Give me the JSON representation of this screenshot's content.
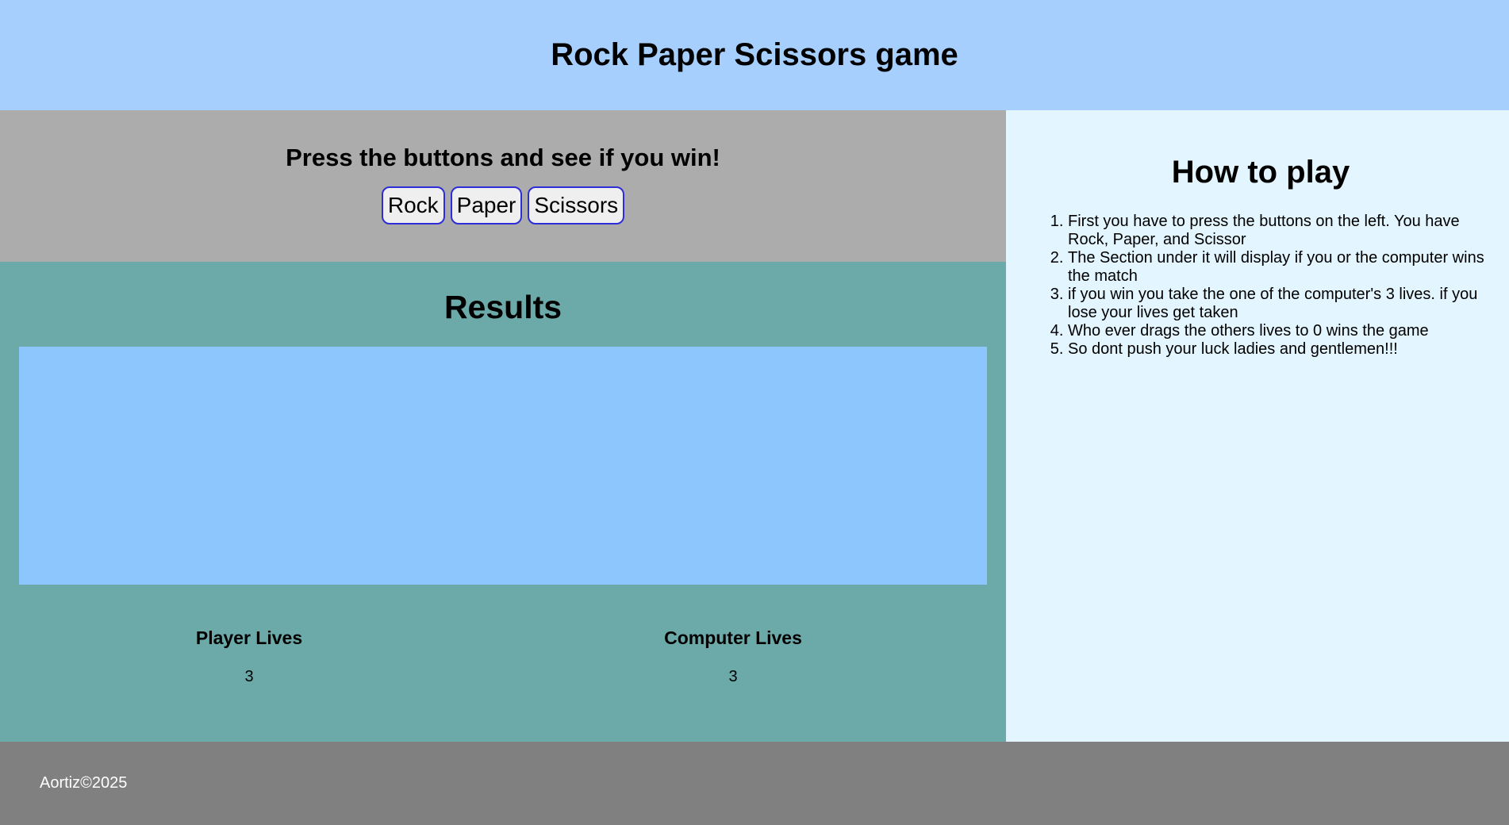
{
  "header": {
    "title": "Rock Paper Scissors game"
  },
  "controls": {
    "prompt": "Press the buttons and see if you win!",
    "buttons": [
      "Rock",
      "Paper",
      "Scissors"
    ]
  },
  "results": {
    "title": "Results",
    "output": "",
    "player_label": "Player Lives",
    "player_lives": "3",
    "computer_label": "Computer Lives",
    "computer_lives": "3"
  },
  "how_to_play": {
    "title": "How to play",
    "steps": [
      "First you have to press the buttons on the left. You have Rock, Paper, and Scissor",
      "The Section under it will display if you or the computer wins the match",
      "if you win you take the one of the computer's 3 lives. if you lose your lives get taken",
      "Who ever drags the others lives to 0 wins the game",
      "So dont push your luck ladies and gentlemen!!!"
    ]
  },
  "footer": {
    "text": "Aortiz©2025"
  },
  "colors": {
    "header_bg": "#a6cffe",
    "controls_bg": "#acacac",
    "results_bg": "#6ca9a9",
    "result_box_bg": "#8dc6fd",
    "sidebar_bg": "#e3f5fe",
    "footer_bg": "#808080",
    "button_border": "#2e2ed6"
  }
}
